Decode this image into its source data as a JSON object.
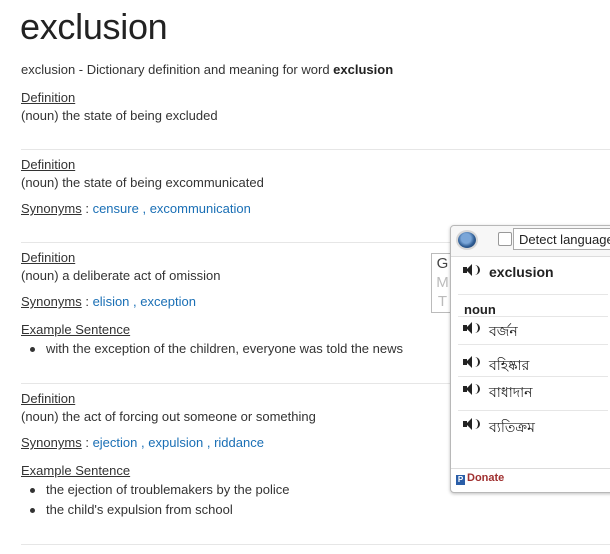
{
  "page": {
    "title": "exclusion",
    "subtitle_prefix": "exclusion - Dictionary definition and meaning for word ",
    "subtitle_word": "exclusion"
  },
  "labels": {
    "definition": "Definition",
    "synonyms": "Synonyms",
    "colon": " :",
    "example_sentence": "Example Sentence"
  },
  "entries": [
    {
      "definition": "(noun) the state of being excluded"
    },
    {
      "definition": "(noun) the state of being excommunicated",
      "synonyms": [
        "censure",
        "excommunication"
      ]
    },
    {
      "definition": "(noun) a deliberate act of omission",
      "synonyms": [
        "elision",
        "exception"
      ],
      "examples": [
        "with the exception of the children, everyone was told the news"
      ]
    },
    {
      "definition": "(noun) the act of forcing out someone or something",
      "synonyms": [
        "ejection",
        "expulsion",
        "riddance"
      ],
      "examples": [
        "the ejection of troublemakers by the police",
        "the child's expulsion from school"
      ]
    }
  ],
  "popup": {
    "tabs": [
      "G",
      "M",
      "T"
    ],
    "detect_language": "Detect language",
    "word": "exclusion",
    "part_of_speech": "noun",
    "translations": [
      "বর্জন",
      "বহিষ্কার",
      "বাধাদান",
      "ব্যতিক্রম"
    ],
    "donate": "Donate",
    "icons": {
      "globe": "globe-icon",
      "speaker": "speaker-icon",
      "paypal": "paypal-icon"
    }
  }
}
